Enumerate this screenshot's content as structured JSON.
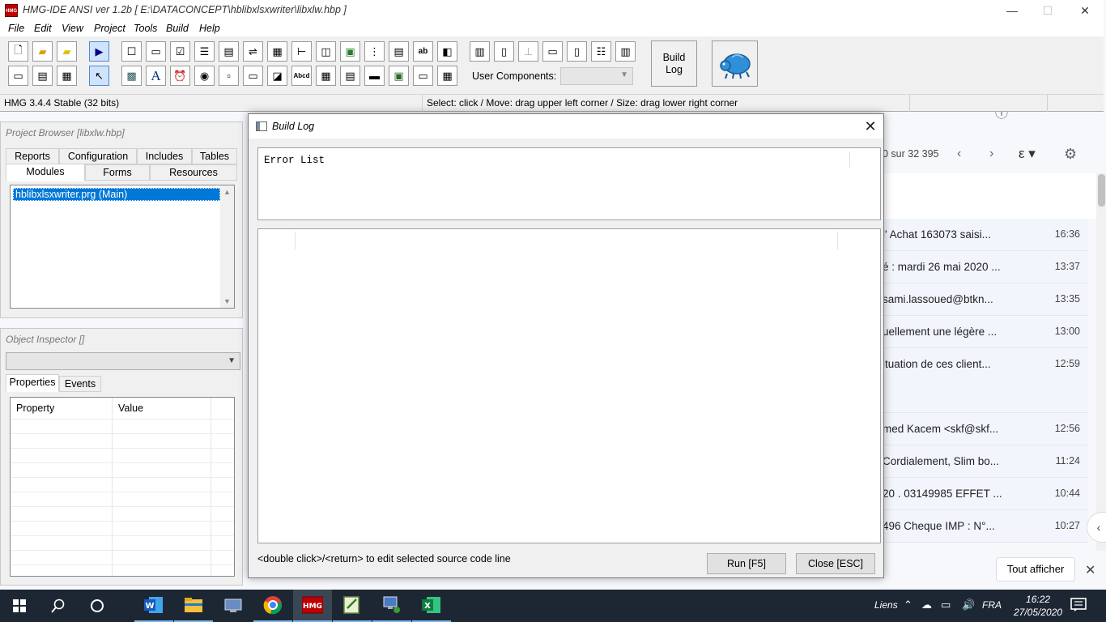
{
  "background_app": {
    "count_text": "0 sur 32 395",
    "rows": [
      {
        "text": "l' Achat 163073 saisi...",
        "time": "16:36"
      },
      {
        "text": "é : mardi 26 mai 2020 ...",
        "time": "13:37"
      },
      {
        "text": "sami.lassoued@btkn...",
        "time": "13:35"
      },
      {
        "text": "uellement une légère ...",
        "time": "13:00"
      },
      {
        "text": "ituation de ces client...",
        "time": "12:59"
      },
      {
        "text": "med Kacem <skf@skf...",
        "time": "12:56"
      },
      {
        "text": "Cordialement, Slim bo...",
        "time": "11:24"
      },
      {
        "text": "20 . 03149985 EFFET ...",
        "time": "10:44"
      },
      {
        "text": "496 Cheque IMP : N°...",
        "time": "10:27"
      }
    ],
    "show_all_label": "Tout afficher",
    "close_symbol": "✕"
  },
  "ide": {
    "app_icon_text": "HMG",
    "title": "HMG-IDE  ANSI  ver 1.2b  [ E:\\DATACONCEPT\\hblibxlsxwriter\\libxlw.hbp ]",
    "window_buttons": {
      "minimize": "—",
      "maximize": "☐",
      "close": "✕"
    },
    "menu": [
      "File",
      "Edit",
      "View",
      "Project",
      "Tools",
      "Build",
      "Help"
    ],
    "build_log_label_1": "Build",
    "build_log_label_2": "Log",
    "user_components_label": "User Components:",
    "user_components_value": "",
    "status": {
      "version": "HMG 3.4.4 Stable (32 bits)",
      "hint": "Select: click / Move: drag upper left corner / Size: drag lower right corner"
    }
  },
  "project_browser": {
    "caption": "Project Browser [libxlw.hbp]",
    "tabs_row1": [
      "Reports",
      "Configuration",
      "Includes",
      "Tables"
    ],
    "tabs_row2": [
      "Modules",
      "Forms",
      "Resources"
    ],
    "selected_tab": "Modules",
    "items": [
      "hblibxlsxwriter.prg (Main)"
    ]
  },
  "object_inspector": {
    "caption": "Object Inspector []",
    "combo_value": "",
    "tabs": [
      "Properties",
      "Events"
    ],
    "columns": [
      "Property",
      "Value"
    ]
  },
  "build_log": {
    "title": "Build Log",
    "error_list_text": "Error List",
    "hint": "<double click>/<return> to edit selected source code line",
    "run_label": "Run [F5]",
    "close_label": "Close [ESC]"
  },
  "taskbar": {
    "tray_label": "Liens",
    "language": "FRA",
    "time": "16:22",
    "date": "27/05/2020"
  }
}
